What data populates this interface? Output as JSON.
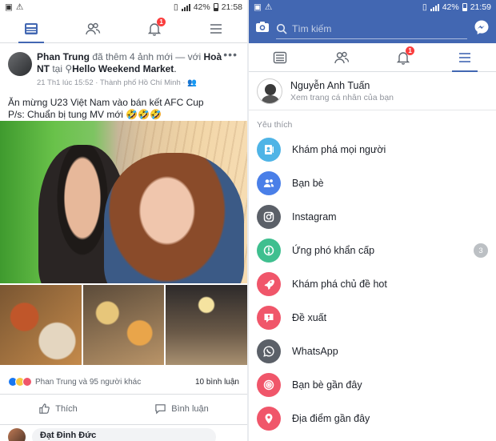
{
  "left": {
    "status": {
      "battery": "42%",
      "time": "21:58"
    },
    "nav": {
      "notification_count": "1"
    },
    "post": {
      "author": "Phan Trung",
      "action": " đã thêm 4 ảnh mới — với ",
      "tagged": "Hoà NT",
      "at": " tại ",
      "place": "Hello Weekend Market",
      "period": ".",
      "meta": "21 Th1 lúc 15:52 · Thành phố Hồ Chí Minh · ",
      "caption_line1": "Ăn mừng U23 Việt Nam vào bán kết AFC Cup",
      "caption_line2": "P/s: Chuẩn bị tung MV mới 🤣🤣🤣",
      "reactions_text": "Phan Trung và 95 người khác",
      "comments_count": "10 bình luận",
      "like_label": "Thích",
      "comment_label": "Bình luận",
      "commenter": "Đạt Đinh Đức"
    }
  },
  "right": {
    "status": {
      "battery": "42%",
      "time": "21:59"
    },
    "search": {
      "placeholder": "Tìm kiếm"
    },
    "nav": {
      "notification_count": "1"
    },
    "profile": {
      "name": "Nguyễn Anh Tuấn",
      "subtitle": "Xem trang cá nhân của bạn"
    },
    "section_title": "Yêu thích",
    "menu": [
      {
        "label": "Khám phá mọi người",
        "color": "#4fb4e6"
      },
      {
        "label": "Bạn bè",
        "color": "#4a7fe8"
      },
      {
        "label": "Instagram",
        "color": "#5b6068"
      },
      {
        "label": "Ứng phó khẩn cấp",
        "color": "#3fbf8f",
        "count": "3"
      },
      {
        "label": "Khám phá chủ đề hot",
        "color": "#f0566a"
      },
      {
        "label": "Đề xuất",
        "color": "#f0566a"
      },
      {
        "label": "WhatsApp",
        "color": "#5b6068"
      },
      {
        "label": "Bạn bè gần đây",
        "color": "#f0566a"
      },
      {
        "label": "Địa điểm gần đây",
        "color": "#f0566a"
      }
    ]
  },
  "colors": {
    "facebook_blue": "#4267b2",
    "badge_red": "#fa3e3e"
  }
}
